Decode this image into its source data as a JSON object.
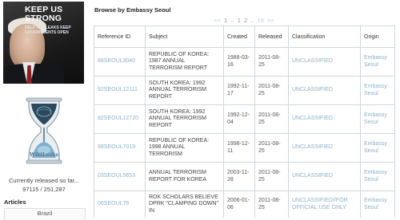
{
  "sidebar": {
    "banner": {
      "title": "KEEP US STRONG",
      "subtitle": "HELP WIKILEAKS KEEP GOVERNMENTS OPEN"
    },
    "logo_text": "WikiLeaks",
    "release_status": "Currently released so far...",
    "release_counts": "97115 / 251,287",
    "articles_heading": "Articles",
    "articles": [
      "Brazil"
    ]
  },
  "main": {
    "heading": "Browse by Embassy Seoul",
    "pagination": {
      "prev": "<<",
      "pages": [
        "1",
        "..",
        "1",
        "2",
        "..",
        "19"
      ],
      "next": ">>"
    },
    "columns": [
      "Reference ID",
      "Subject",
      "Created",
      "Released",
      "Classification",
      "Origin"
    ],
    "rows": [
      {
        "ref": "88SEOUL3040",
        "subject": "REPUBLIC OF KOREA: 1987 ANNUAL TERRORISM REPORT",
        "created": "1988-03-16",
        "released": "2011-08-25",
        "classification": "UNCLASSIFIED",
        "origin": "Embassy Seoul"
      },
      {
        "ref": "92SEOUL12111",
        "subject": "SOUTH KOREA: 1992 ANNUAL TERRORISM REPORT",
        "created": "1992-11-17",
        "released": "2011-08-25",
        "classification": "UNCLASSIFIED",
        "origin": "Embassy Seoul"
      },
      {
        "ref": "92SEOUL12720",
        "subject": "SOUTH KOREA: 1992 ANNUAL TERRORISM REPORT",
        "created": "1992-12-04",
        "released": "2011-08-25",
        "classification": "UNCLASSIFIED",
        "origin": "Embassy Seoul"
      },
      {
        "ref": "98SEOUL7019",
        "subject": "REPUBLIC OF KOREA: 1998 ANNUAL TERRORISM",
        "created": "1998-12-11",
        "released": "2011-08-25",
        "classification": "UNCLASSIFIED",
        "origin": "Embassy Seoul"
      },
      {
        "ref": "03SEOUL5653",
        "subject": "ANNUAL TERRORISM REPORT FOR KOREA",
        "created": "2003-11-28",
        "released": "2011-08-25",
        "classification": "UNCLASSIFIED",
        "origin": "Embassy Seoul"
      },
      {
        "ref": "06SEOUL76",
        "subject": "ROK SCHOLARS BELIEVE DPRK \"CLAMPING DOWN\" IN",
        "created": "2006-01-06",
        "released": "2011-08-25",
        "classification": "UNCLASSIFIED//FOR OFFICIAL USE ONLY",
        "origin": "Embassy Seoul"
      }
    ]
  }
}
